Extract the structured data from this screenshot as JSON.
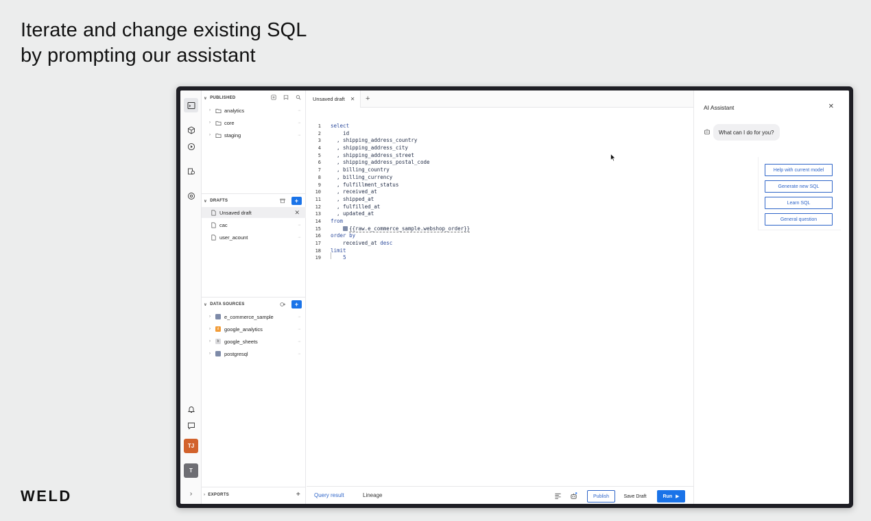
{
  "headline": {
    "line1": "Iterate and change existing SQL",
    "line2": "by prompting our assistant"
  },
  "brand": "WELD",
  "rail": {
    "avatars": [
      {
        "initials": "TJ",
        "color": "#d2622c"
      },
      {
        "initials": "T",
        "color": "#6e6e73"
      }
    ],
    "expand_icon": "chevron-right-icon"
  },
  "sidebar": {
    "published": {
      "title": "PUBLISHED",
      "items": [
        {
          "label": "analytics"
        },
        {
          "label": "core"
        },
        {
          "label": "staging"
        }
      ]
    },
    "drafts": {
      "title": "DRAFTS",
      "add_label": "+",
      "items": [
        {
          "label": "Unsaved draft",
          "selected": true
        },
        {
          "label": "cac"
        },
        {
          "label": "user_acount"
        }
      ]
    },
    "data_sources": {
      "title": "DATA SOURCES",
      "add_label": "+",
      "items": [
        {
          "label": "e_commerce_sample",
          "badge": "",
          "color": "#7d8aa8"
        },
        {
          "label": "google_analytics",
          "badge": "ıl",
          "color": "#f29c38"
        },
        {
          "label": "google_sheets",
          "badge": "b",
          "color": "#d9d9dc"
        },
        {
          "label": "postgresql",
          "badge": "",
          "color": "#7d8aa8"
        }
      ]
    },
    "exports": {
      "title": "EXPORTS",
      "add_label": "+"
    }
  },
  "editor": {
    "tab_label": "Unsaved draft",
    "add_tab": "+",
    "lines": [
      {
        "n": "1",
        "parts": [
          {
            "t": "select",
            "c": "kw"
          }
        ]
      },
      {
        "n": "2",
        "parts": [
          {
            "t": "    id",
            "c": ""
          }
        ]
      },
      {
        "n": "3",
        "parts": [
          {
            "t": "  , shipping_address_country",
            "c": ""
          }
        ]
      },
      {
        "n": "4",
        "parts": [
          {
            "t": "  , shipping_address_city",
            "c": ""
          }
        ]
      },
      {
        "n": "5",
        "parts": [
          {
            "t": "  , shipping_address_street",
            "c": ""
          }
        ]
      },
      {
        "n": "6",
        "parts": [
          {
            "t": "  , shipping_address_postal_code",
            "c": ""
          }
        ]
      },
      {
        "n": "7",
        "parts": [
          {
            "t": "  , billing_country",
            "c": ""
          }
        ]
      },
      {
        "n": "8",
        "parts": [
          {
            "t": "  , billing_currency",
            "c": ""
          }
        ]
      },
      {
        "n": "9",
        "parts": [
          {
            "t": "  , fulfillment_status",
            "c": ""
          }
        ]
      },
      {
        "n": "10",
        "parts": [
          {
            "t": "  , received_at",
            "c": ""
          }
        ]
      },
      {
        "n": "11",
        "parts": [
          {
            "t": "  , shipped_at",
            "c": ""
          }
        ]
      },
      {
        "n": "12",
        "parts": [
          {
            "t": "  , fulfilled_at",
            "c": ""
          }
        ]
      },
      {
        "n": "13",
        "parts": [
          {
            "t": "  , updated_at",
            "c": ""
          }
        ]
      },
      {
        "n": "14",
        "parts": [
          {
            "t": "from",
            "c": "kw"
          }
        ]
      },
      {
        "n": "15",
        "parts": [
          {
            "t": "    ",
            "c": ""
          },
          {
            "t": "{{raw.e_commerce_sample.webshop_order}}",
            "c": "ref"
          }
        ]
      },
      {
        "n": "16",
        "parts": [
          {
            "t": "order by",
            "c": "kw"
          }
        ]
      },
      {
        "n": "17",
        "parts": [
          {
            "t": "    received_at ",
            "c": ""
          },
          {
            "t": "desc",
            "c": "kw"
          }
        ]
      },
      {
        "n": "18",
        "parts": [
          {
            "t": "limit",
            "c": "kw"
          }
        ]
      },
      {
        "n": "19",
        "parts": [
          {
            "t": "    ",
            "c": ""
          },
          {
            "t": "5",
            "c": "num"
          }
        ]
      }
    ],
    "bottom": {
      "query_result": "Query result",
      "lineage": "Lineage",
      "publish": "Publish",
      "save_draft": "Save Draft",
      "run": "Run"
    }
  },
  "assistant": {
    "title": "AI Assistant",
    "greeting": "What can I do for you?",
    "suggestions": [
      "Help with current model",
      "Generate new SQL",
      "Learn SQL",
      "General question"
    ]
  },
  "colors": {
    "accent": "#1a73e8",
    "keyword": "#2d4b9c",
    "suggestion": "#2d64c8"
  }
}
